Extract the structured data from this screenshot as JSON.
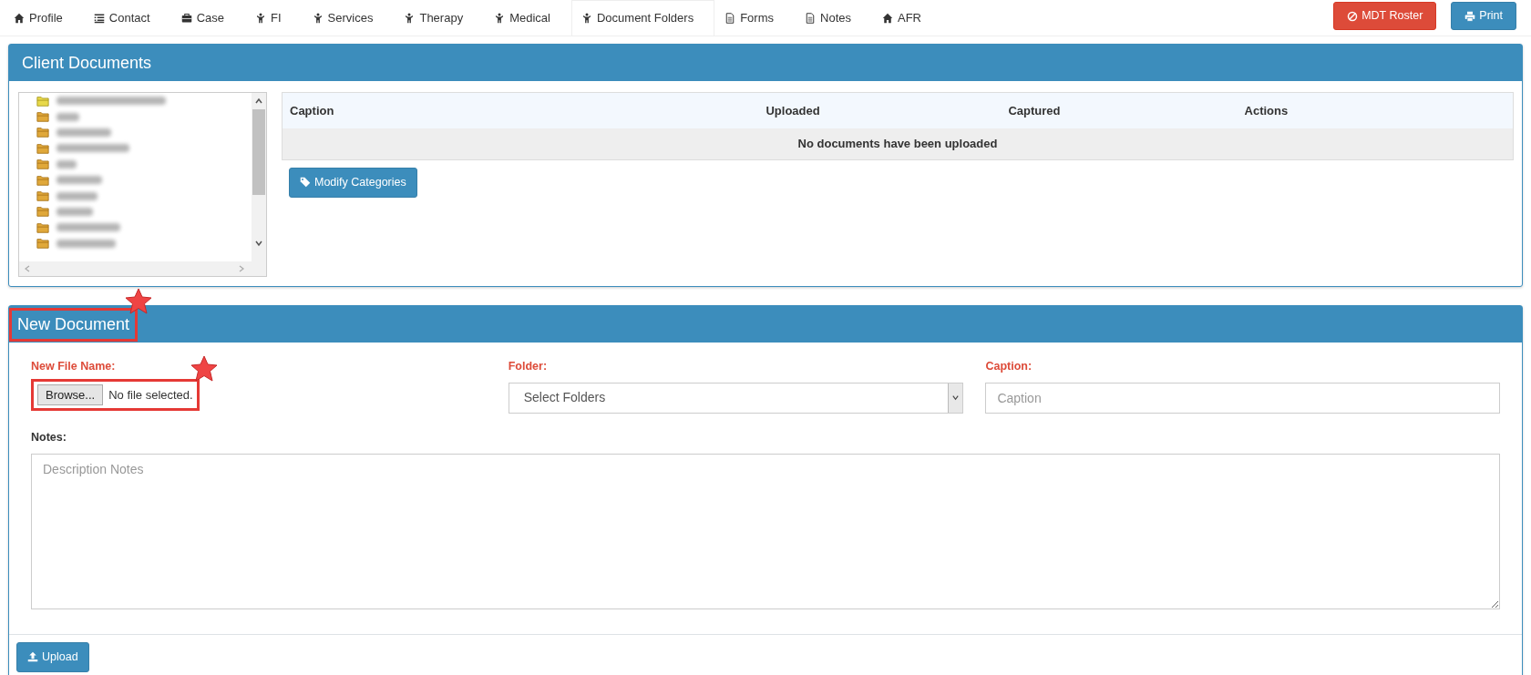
{
  "tabs": [
    {
      "label": "Profile",
      "selected": false
    },
    {
      "label": "Contact",
      "selected": false
    },
    {
      "label": "Case",
      "selected": false
    },
    {
      "label": "FI",
      "selected": false
    },
    {
      "label": "Services",
      "selected": false
    },
    {
      "label": "Therapy",
      "selected": false
    },
    {
      "label": "Medical",
      "selected": false
    },
    {
      "label": "Document Folders",
      "selected": true
    },
    {
      "label": "Forms",
      "selected": false
    },
    {
      "label": "Notes",
      "selected": false
    },
    {
      "label": "AFR",
      "selected": false
    }
  ],
  "header_buttons": [
    {
      "label": "MDT Roster",
      "kind": "danger"
    },
    {
      "label": "Print",
      "kind": "primary"
    }
  ],
  "client_documents": {
    "title": "Client Documents",
    "folders": [
      {
        "selected": true
      },
      {
        "selected": false
      },
      {
        "selected": false
      },
      {
        "selected": false
      },
      {
        "selected": false
      },
      {
        "selected": false
      },
      {
        "selected": false
      },
      {
        "selected": false
      },
      {
        "selected": false
      },
      {
        "selected": false
      }
    ],
    "table": {
      "columns": [
        "Caption",
        "Uploaded",
        "Captured",
        "Actions"
      ],
      "empty_message": "No documents have been uploaded"
    },
    "modify_button": "Modify Categories"
  },
  "new_document": {
    "title": "New Document",
    "title_highlighted": true,
    "file_label": "New File Name:",
    "browse_button": "Browse...",
    "file_status": "No file selected.",
    "file_highlighted": true,
    "folder_label": "Folder:",
    "folder_select": "Select Folders",
    "caption_label": "Caption:",
    "caption_placeholder": "Caption",
    "notes_label": "Notes:",
    "notes_placeholder": "Description Notes",
    "upload_button": "Upload"
  }
}
